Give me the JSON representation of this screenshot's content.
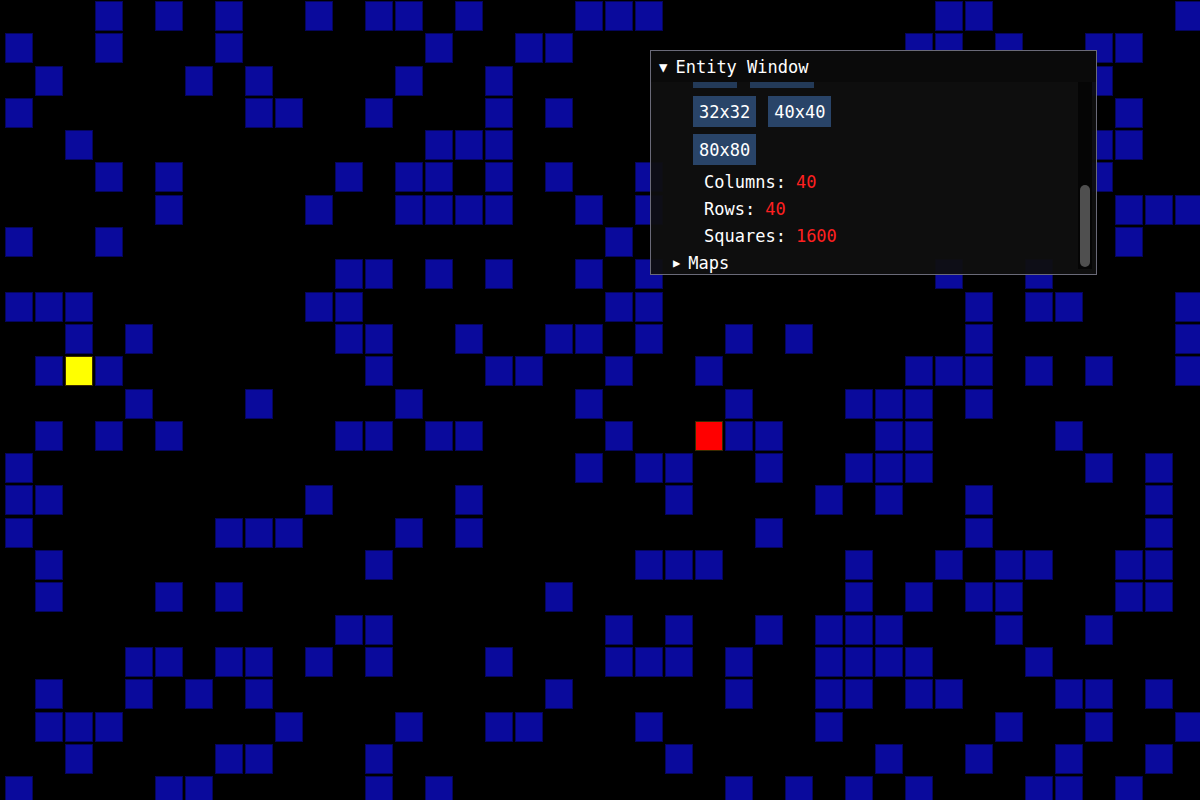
{
  "window": {
    "title": "Entity Window",
    "collapse_icon": "▼"
  },
  "clipped_buttons": [
    {
      "cut": true
    },
    {
      "cut": true
    }
  ],
  "size_buttons": [
    {
      "label": "32x32"
    },
    {
      "label": "40x40"
    },
    {
      "label": "80x80"
    }
  ],
  "stats": [
    {
      "label": "Columns:",
      "value": "40"
    },
    {
      "label": "Rows:",
      "value": "40"
    },
    {
      "label": "Squares:",
      "value": "1600"
    }
  ],
  "tree": [
    {
      "label": "Maps",
      "icon": "▶",
      "expanded": false
    }
  ],
  "scrollbar": {
    "level": 0.45,
    "at_end": true
  },
  "board": {
    "walls": [
      [
        3,
        5,
        7,
        10,
        12,
        13,
        15,
        19,
        20,
        21,
        31,
        32,
        39
      ],
      [
        0,
        3,
        7,
        14,
        17,
        18,
        30,
        31,
        33,
        36,
        37
      ],
      [
        1,
        6,
        8,
        13,
        16,
        36
      ],
      [
        0,
        8,
        9,
        12,
        16,
        18,
        37
      ],
      [
        2,
        14,
        15,
        16,
        36,
        37
      ],
      [
        3,
        5,
        11,
        13,
        14,
        16,
        18,
        21,
        36
      ],
      [
        5,
        10,
        13,
        14,
        15,
        16,
        19,
        21,
        37,
        38,
        39
      ],
      [
        0,
        3,
        20,
        37
      ],
      [
        11,
        12,
        14,
        16,
        19,
        21,
        31,
        34
      ],
      [
        0,
        1,
        2,
        10,
        11,
        20,
        21,
        32,
        34,
        35,
        39
      ],
      [
        2,
        4,
        11,
        12,
        15,
        18,
        19,
        21,
        24,
        26,
        32,
        39
      ],
      [
        1,
        3,
        12,
        16,
        17,
        20,
        23,
        30,
        31,
        32,
        34,
        36,
        39
      ],
      [
        4,
        8,
        13,
        19,
        24,
        28,
        29,
        30,
        32
      ],
      [
        1,
        3,
        5,
        11,
        12,
        14,
        15,
        20,
        24,
        25,
        29,
        30,
        35
      ],
      [
        0,
        19,
        21,
        22,
        25,
        28,
        29,
        30,
        36,
        38
      ],
      [
        0,
        1,
        10,
        15,
        22,
        27,
        29,
        32,
        38
      ],
      [
        0,
        7,
        8,
        9,
        13,
        15,
        25,
        32,
        38
      ],
      [
        1,
        12,
        21,
        22,
        23,
        28,
        31,
        33,
        34,
        37,
        38
      ],
      [
        1,
        5,
        7,
        18,
        28,
        30,
        32,
        33,
        37,
        38
      ],
      [
        11,
        12,
        20,
        22,
        25,
        27,
        28,
        29,
        33,
        36
      ],
      [
        4,
        5,
        7,
        8,
        10,
        12,
        16,
        20,
        21,
        22,
        24,
        27,
        28,
        29,
        30,
        34
      ],
      [
        1,
        4,
        6,
        8,
        18,
        24,
        27,
        28,
        30,
        31,
        35,
        36,
        38
      ],
      [
        1,
        2,
        3,
        9,
        13,
        16,
        17,
        21,
        27,
        33,
        36,
        39
      ],
      [
        2,
        7,
        8,
        12,
        22,
        29,
        32,
        35,
        38
      ],
      [
        0,
        5,
        6,
        12,
        14,
        24,
        26,
        28,
        30,
        34,
        35,
        37
      ]
    ],
    "start": {
      "row": 11,
      "col": 2,
      "color": "#ffff00"
    },
    "goal": {
      "row": 13,
      "col": 23,
      "color": "#ff0000"
    }
  }
}
